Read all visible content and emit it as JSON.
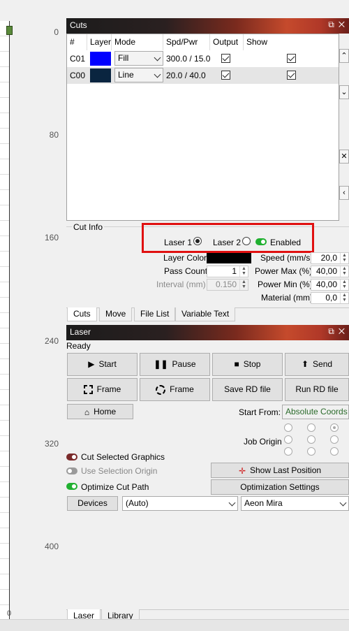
{
  "ruler": {
    "ticks": [
      "0",
      "80",
      "160",
      "240",
      "320",
      "400"
    ],
    "bottom_zero": "0"
  },
  "cuts_panel": {
    "title": "Cuts",
    "columns": [
      "#",
      "Layer",
      "Mode",
      "Spd/Pwr",
      "Output",
      "Show"
    ],
    "rows": [
      {
        "id": "C01",
        "color": "#0000ff",
        "mode": "Fill",
        "spd_pwr": "300.0 / 15.0",
        "output": true,
        "show": true
      },
      {
        "id": "C00",
        "color": "#0a2540",
        "mode": "Line",
        "spd_pwr": "20.0 / 40.0",
        "output": true,
        "show": true
      }
    ],
    "cut_info": {
      "title": "Cut Info",
      "laser1": "Laser 1",
      "laser2": "Laser 2",
      "enabled": "Enabled",
      "layer_color_label": "Layer Color",
      "layer_color": "#000000",
      "pass_count_label": "Pass Count",
      "pass_count": "1",
      "interval_label": "Interval (mm)",
      "interval": "0.150",
      "speed_label": "Speed (mm/s)",
      "speed": "20,0",
      "power_max_label": "Power Max (%)",
      "power_max": "40,00",
      "power_min_label": "Power Min (%)",
      "power_min": "40,00",
      "material_label": "Material (mm)",
      "material": "0,0"
    },
    "tabs": [
      "Cuts",
      "Move",
      "File List",
      "Variable Text"
    ]
  },
  "laser_panel": {
    "title": "Laser",
    "status": "Ready",
    "start": "Start",
    "pause": "Pause",
    "stop": "Stop",
    "send": "Send",
    "frame1": "Frame",
    "frame2": "Frame",
    "save_rd": "Save RD file",
    "run_rd": "Run RD file",
    "home": "Home",
    "start_from_label": "Start From:",
    "start_from": "Absolute Coords",
    "job_origin_label": "Job Origin",
    "cut_selected": "Cut Selected Graphics",
    "use_selection_origin": "Use Selection Origin",
    "optimize_cut_path": "Optimize Cut Path",
    "show_last_position": "Show Last Position",
    "optimization_settings": "Optimization Settings",
    "devices": "Devices",
    "device_port": "(Auto)",
    "device_name": "Aeon Mira"
  },
  "bottom_tabs": [
    "Laser",
    "Library"
  ],
  "colors": {
    "highlight_box": "#e01010",
    "toggle_on": "#20b030",
    "accent_text": "#2a6a2a"
  }
}
